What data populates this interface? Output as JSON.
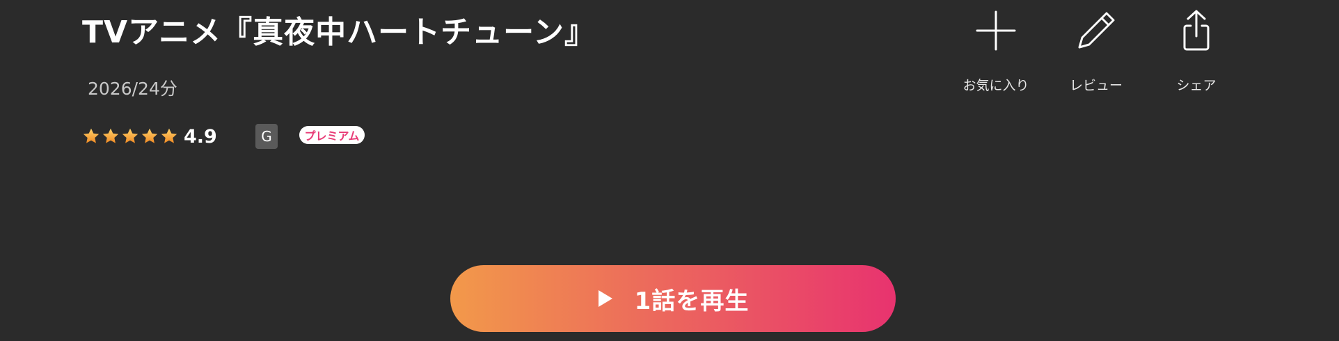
{
  "title": "TVアニメ『真夜中ハートチューン』",
  "meta": "2026/24分",
  "rating": {
    "stars": 5,
    "value": "4.9"
  },
  "age_badge": "G",
  "premium_badge": "プレミアム",
  "actions": {
    "favorite": {
      "label": "お気に入り",
      "icon": "plus-icon"
    },
    "review": {
      "label": "レビュー",
      "icon": "pencil-icon"
    },
    "share": {
      "label": "シェア",
      "icon": "share-icon"
    }
  },
  "play_button": {
    "label": "1話を再生",
    "icon": "play-icon"
  },
  "colors": {
    "background": "#2b2b2b",
    "star": "#f5a623",
    "premium_text": "#e83b76",
    "gradient_start": "#f2994a",
    "gradient_end": "#e8336f"
  }
}
